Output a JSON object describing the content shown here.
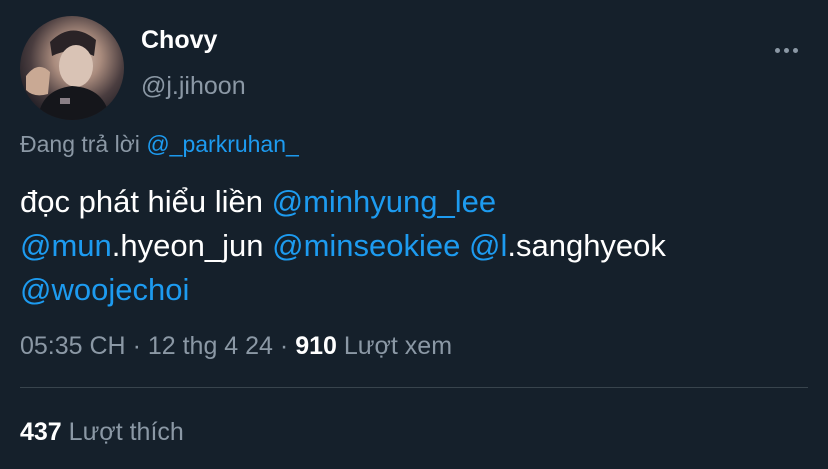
{
  "author": {
    "display_name": "Chovy",
    "handle": "@j.jihoon"
  },
  "reply": {
    "prefix": "Đang trả lời",
    "to": "@_parkruhan_"
  },
  "tweet": {
    "text_1": "đọc phát hiểu liền ",
    "mention_1": "@minhyung_lee",
    "mention_2_link": "@mun",
    "mention_2_rest": ".hyeon_jun",
    "mention_3": "@minseokiee",
    "mention_4_link": "@l",
    "mention_4_rest": ".sanghyeok",
    "mention_5": "@woojechoi"
  },
  "meta": {
    "time": "05:35 CH",
    "sep": " · ",
    "date": "12 thg 4 24",
    "views_count": "910",
    "views_label": "Lượt xem"
  },
  "engagement": {
    "likes_count": "437",
    "likes_label": "Lượt thích"
  },
  "icons": {
    "more": "more-horizontal-icon"
  }
}
